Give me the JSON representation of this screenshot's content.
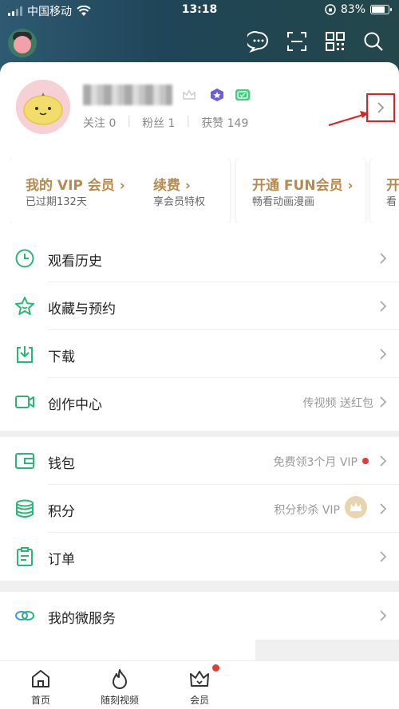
{
  "status_bar": {
    "carrier": "中国移动",
    "time": "13:18",
    "battery": "83%",
    "battery_level": 0.83
  },
  "topnav": {
    "icons": [
      "message-icon",
      "scan-icon",
      "qr-code-icon",
      "search-icon"
    ]
  },
  "profile": {
    "following_label": "关注",
    "following_count": "0",
    "fans_label": "粉丝",
    "fans_count": "1",
    "likes_label": "获赞",
    "likes_count": "149"
  },
  "vip_cards": [
    {
      "title": "我的 VIP 会员 ›",
      "subtitle": "已过期132天"
    },
    {
      "title": "续费 ›",
      "subtitle": "享会员特权"
    },
    {
      "title": "开通 FUN会员 ›",
      "subtitle": "畅看动画漫画"
    },
    {
      "title": "开",
      "subtitle": "看"
    }
  ],
  "menu_group1": [
    {
      "label": "观看历史",
      "hint": ""
    },
    {
      "label": "收藏与预约",
      "hint": ""
    },
    {
      "label": "下载",
      "hint": ""
    },
    {
      "label": "创作中心",
      "hint": "传视频 送红包"
    }
  ],
  "menu_group2": [
    {
      "label": "钱包",
      "hint": "免费领3个月 VIP"
    },
    {
      "label": "积分",
      "hint": "积分秒杀 VIP"
    },
    {
      "label": "订单",
      "hint": ""
    }
  ],
  "menu_group3": [
    {
      "label": "我的微服务",
      "hint": ""
    }
  ],
  "tabbar": {
    "home": "首页",
    "moments": "随刻视频",
    "vip": "会员"
  },
  "colors": {
    "accent_green": "#2bb673",
    "vip_gold": "#b78a4d",
    "highlight_red": "#e02020"
  }
}
